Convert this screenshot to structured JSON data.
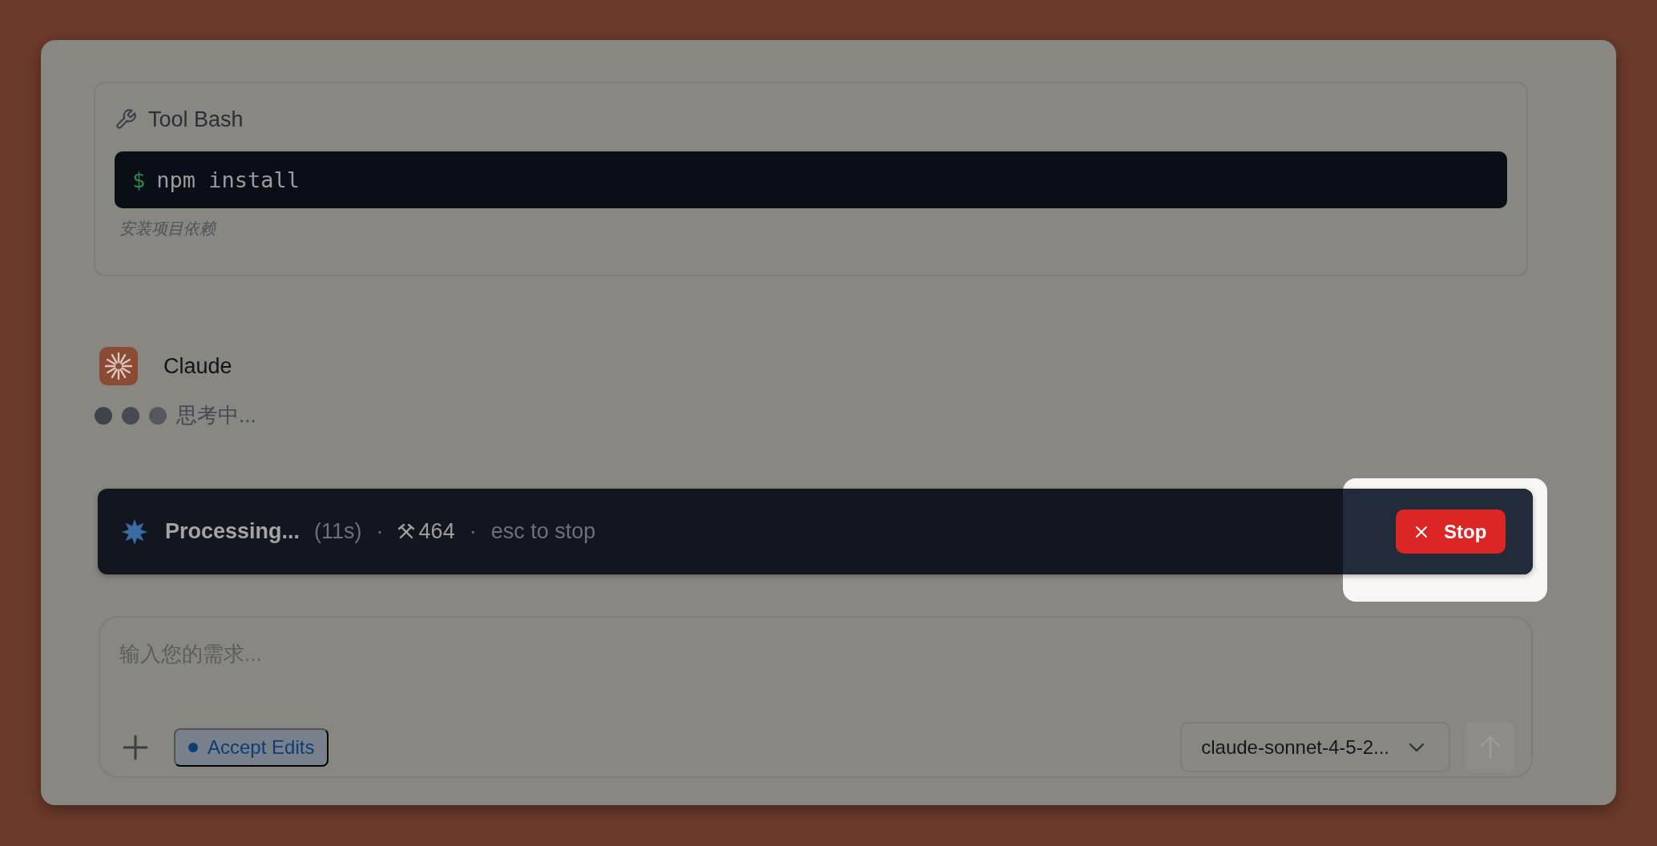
{
  "tool_card": {
    "title": "Tool Bash",
    "prompt": "$",
    "command": "npm install",
    "description": "安装项目依赖"
  },
  "message": {
    "author": "Claude",
    "status": "思考中..."
  },
  "status_bar": {
    "label": "Processing...",
    "elapsed": "(11s)",
    "separator_1": "·",
    "tokens": "464",
    "separator_2": "·",
    "hint": "esc to stop",
    "stop_button": "Stop",
    "highlighted": true
  },
  "composer": {
    "placeholder": "输入您的需求...",
    "mode_badge": "Accept Edits",
    "model": "claude-sonnet-4-5-2...",
    "send_disabled": true
  }
}
